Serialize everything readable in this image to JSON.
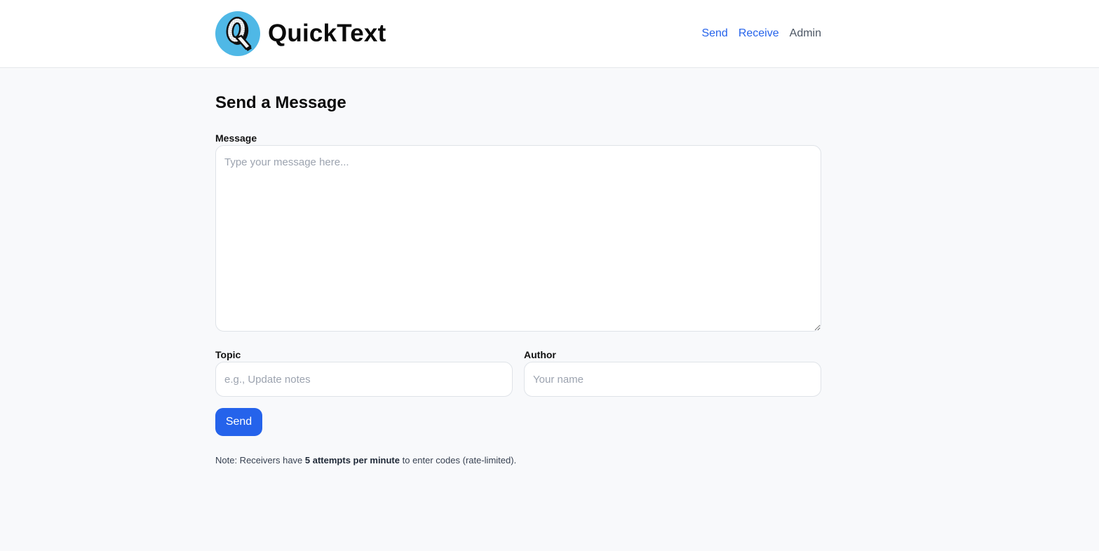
{
  "header": {
    "brand_name": "QuickText",
    "logo_letter": "Q",
    "nav": [
      {
        "label": "Send",
        "color": "#2563eb"
      },
      {
        "label": "Receive",
        "color": "#2563eb"
      },
      {
        "label": "Admin",
        "color": "#4b5563"
      }
    ]
  },
  "main": {
    "title": "Send a Message",
    "message_label": "Message",
    "message_placeholder": "Type your message here...",
    "message_value": "",
    "topic_label": "Topic",
    "topic_placeholder": "e.g., Update notes",
    "topic_value": "",
    "author_label": "Author",
    "author_placeholder": "Your name",
    "author_value": "",
    "send_label": "Send",
    "note_prefix": "Note: Receivers have ",
    "note_bold": "5 attempts per minute",
    "note_suffix": " to enter codes (rate-limited)."
  },
  "colors": {
    "accent": "#2563eb",
    "background": "#f8f9fb",
    "logo_bg": "#4fb8e6"
  }
}
